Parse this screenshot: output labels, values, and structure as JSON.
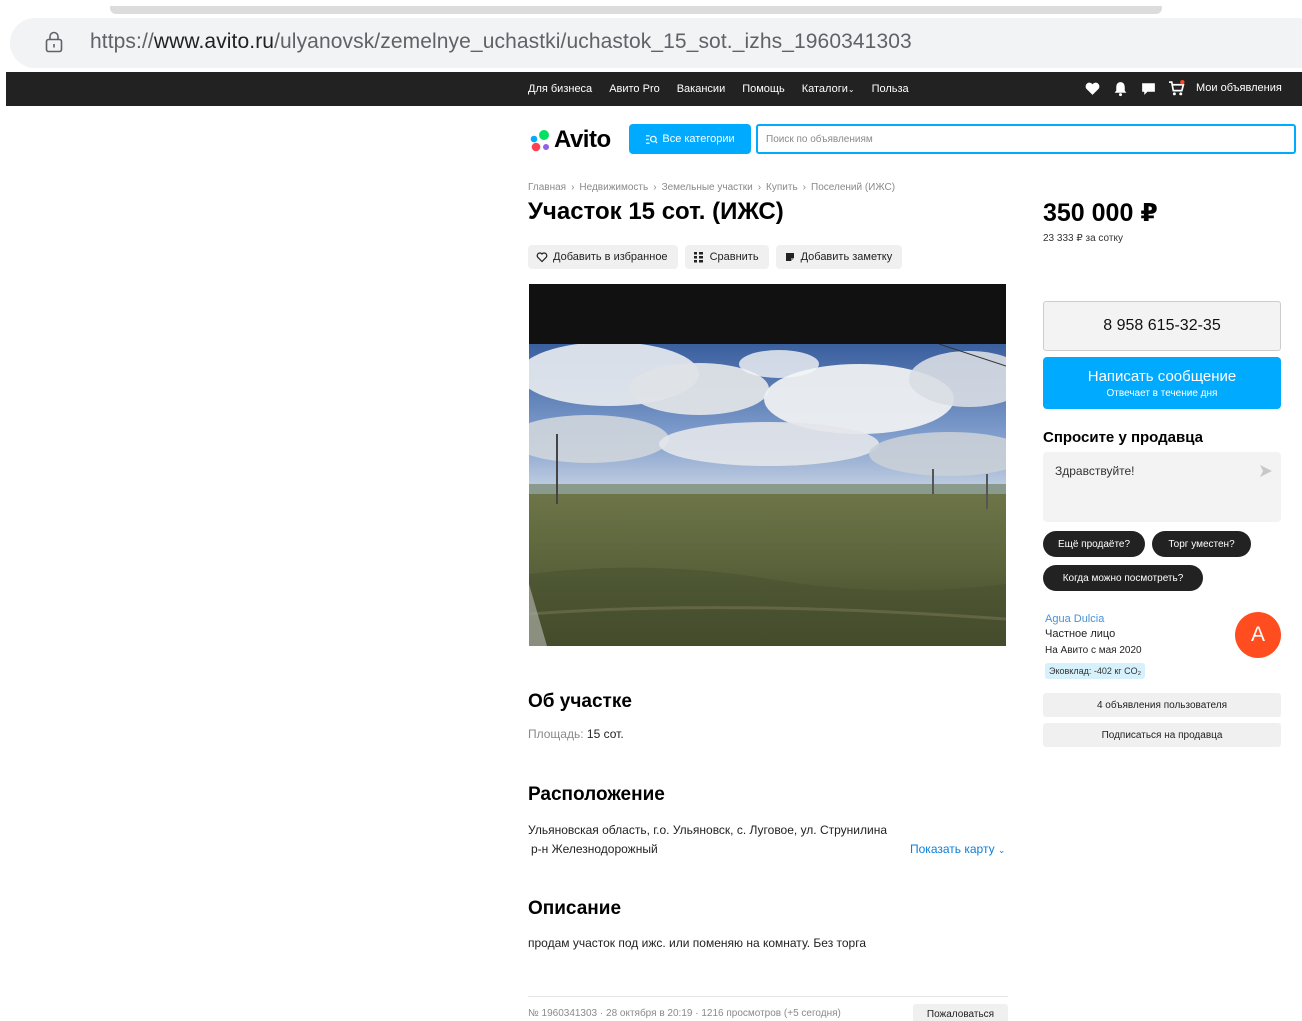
{
  "browser": {
    "url_prefix": "https://",
    "url_host": "www.avito.ru",
    "url_path": "/ulyanovsk/zemelnye_uchastki/uchastok_15_sot._izhs_1960341303"
  },
  "topnav": {
    "links": [
      "Для бизнеса",
      "Авито Pro",
      "Вакансии",
      "Помощь",
      "Каталоги",
      "Польза"
    ],
    "my_ads": "Мои объявления"
  },
  "header": {
    "logo": "Avito",
    "categories_button": "Все категории",
    "search_placeholder": "Поиск по объявлениям"
  },
  "breadcrumbs": [
    "Главная",
    "Недвижимость",
    "Земельные участки",
    "Купить",
    "Поселений (ИЖС)"
  ],
  "listing": {
    "title": "Участок 15 сот. (ИЖС)",
    "actions": {
      "favorite": "Добавить в избранное",
      "compare": "Сравнить",
      "note": "Добавить заметку"
    },
    "about_title": "Об участке",
    "area_label": "Площадь:",
    "area_value": "15 сот.",
    "location_title": "Расположение",
    "address_line1": "Ульяновская область, г.о. Ульяновск, с. Луговое, ул. Струнилина",
    "address_line2": "р-н Железнодорожный",
    "show_map": "Показать карту",
    "description_title": "Описание",
    "description": "продам участок под ижс. или поменяю на комнату. Без торга",
    "meta": "№ 1960341303 · 28 октября в 20:19 · 1216 просмотров (+5 сегодня)",
    "complain": "Пожаловаться"
  },
  "sidebar": {
    "price": "350 000 ₽",
    "price_per": "23 333 ₽ за сотку",
    "phone": "8 958 615-32-35",
    "message_button": "Написать сообщение",
    "message_sub": "Отвечает в течение дня",
    "ask_title": "Спросите у продавца",
    "ask_text": "Здравствуйте!",
    "chips": [
      "Ещё продаёте?",
      "Торг уместен?",
      "Когда можно посмотреть?"
    ],
    "seller_name": "Agua Dulcia",
    "seller_type": "Частное лицо",
    "seller_since": "На Авито с мая 2020",
    "eco": "Эковклад: -402 кг CO₂",
    "avatar_letter": "A",
    "user_ads": "4 объявления пользователя",
    "subscribe": "Подписаться на продавца"
  },
  "colors": {
    "accent": "#00aaff",
    "nav_bg": "#222222",
    "avatar": "#ff4d20"
  }
}
